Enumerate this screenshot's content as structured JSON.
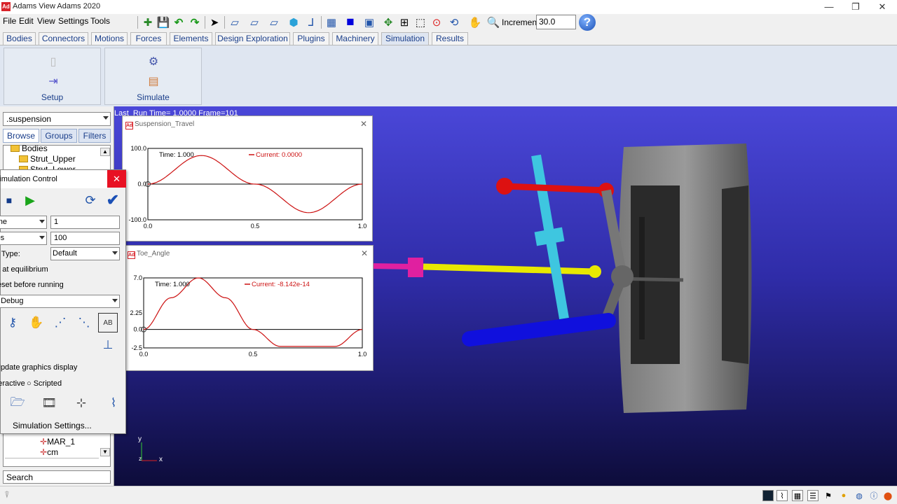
{
  "window": {
    "title": "Adams View Adams 2020",
    "logo_text": "Ad",
    "controls": [
      "—",
      "❐",
      "✕"
    ]
  },
  "menu": [
    "File",
    "Edit",
    "View",
    "Settings",
    "Tools"
  ],
  "toolbar": {
    "icons": [
      "new-icon",
      "save-icon",
      "undo-icon",
      "redo-icon",
      "select-icon",
      "view-front-icon",
      "view-side-icon",
      "view-iso-icon",
      "view-3d-icon",
      "axes-icon",
      "mesh-icon",
      "color-fill-icon",
      "render-icon",
      "fit-icon",
      "zoom-box-icon",
      "zoom-window-icon",
      "center-icon",
      "rotate-icon",
      "pan-icon",
      "zoom-icon"
    ],
    "increment_label": "Increment",
    "increment_value": "30.0",
    "help_label": "?"
  },
  "tabs": [
    "Bodies",
    "Connectors",
    "Motions",
    "Forces",
    "Elements",
    "Design Exploration",
    "Plugins",
    "Machinery",
    "Simulation",
    "Results"
  ],
  "active_tab": "Simulation",
  "ribbon": {
    "groups": [
      {
        "label": "Setup"
      },
      {
        "label": "Simulate"
      }
    ]
  },
  "left_panel": {
    "model": ".suspension",
    "tabs": [
      "Browse",
      "Groups",
      "Filters"
    ],
    "tree": [
      "Bodies",
      "Strut_Upper",
      "Strut_Lower",
      "MAR_1",
      "cm"
    ],
    "search": "Search"
  },
  "viewport": {
    "status": "Last_Run   Time= 1.0000  Frame=101",
    "triad_y": "y",
    "triad_x": "x",
    "triad_z": "z"
  },
  "plots": [
    {
      "title": "Suspension_Travel",
      "time_label": "Time:  1.000",
      "current_label": "Current:  0.0000",
      "y_ticks": [
        "100.0",
        "0.0",
        "-100.0"
      ],
      "x_ticks": [
        "0.0",
        "0.5",
        "1.0"
      ]
    },
    {
      "title": "Toe_Angle",
      "time_label": "Time:  1.000",
      "current_label": "Current:  -8.142e-14",
      "y_ticks": [
        "7.0",
        "2.25",
        "0.0",
        "-2.5"
      ],
      "x_ticks": [
        "0.0",
        "0.5",
        "1.0"
      ]
    }
  ],
  "chart_data": [
    {
      "type": "line",
      "title": "Suspension_Travel",
      "x": [
        0,
        0.25,
        0.5,
        0.75,
        1.0
      ],
      "series": [
        {
          "values": [
            0,
            80,
            0,
            -80,
            0
          ]
        }
      ],
      "xlim": [
        0,
        1
      ],
      "ylim": [
        -100,
        100
      ]
    },
    {
      "type": "line",
      "title": "Toe_Angle",
      "x": [
        0,
        0.125,
        0.25,
        0.375,
        0.5,
        0.625,
        0.75,
        0.875,
        1.0
      ],
      "series": [
        {
          "values": [
            0,
            4.3,
            7.0,
            4.3,
            0,
            -2.3,
            -2.3,
            -2.3,
            0
          ]
        }
      ],
      "xlim": [
        0,
        1
      ],
      "ylim": [
        -2.5,
        7.0
      ]
    }
  ],
  "sim_control": {
    "title": "Simulation Control",
    "close": "✕",
    "end_type": "Time",
    "end_value": "1",
    "steps_type": "Steps",
    "steps_value": "100",
    "sim_type_label": "Sim. Type:",
    "sim_type_value": "Default",
    "start_equilibrium": "Start at equilibrium",
    "reset_before": "Reset before running",
    "debug": "No Debug",
    "update_graphics": "Update graphics display",
    "interactive": "Interactive",
    "scripted": "Scripted",
    "settings_label": "Simulation Settings..."
  }
}
